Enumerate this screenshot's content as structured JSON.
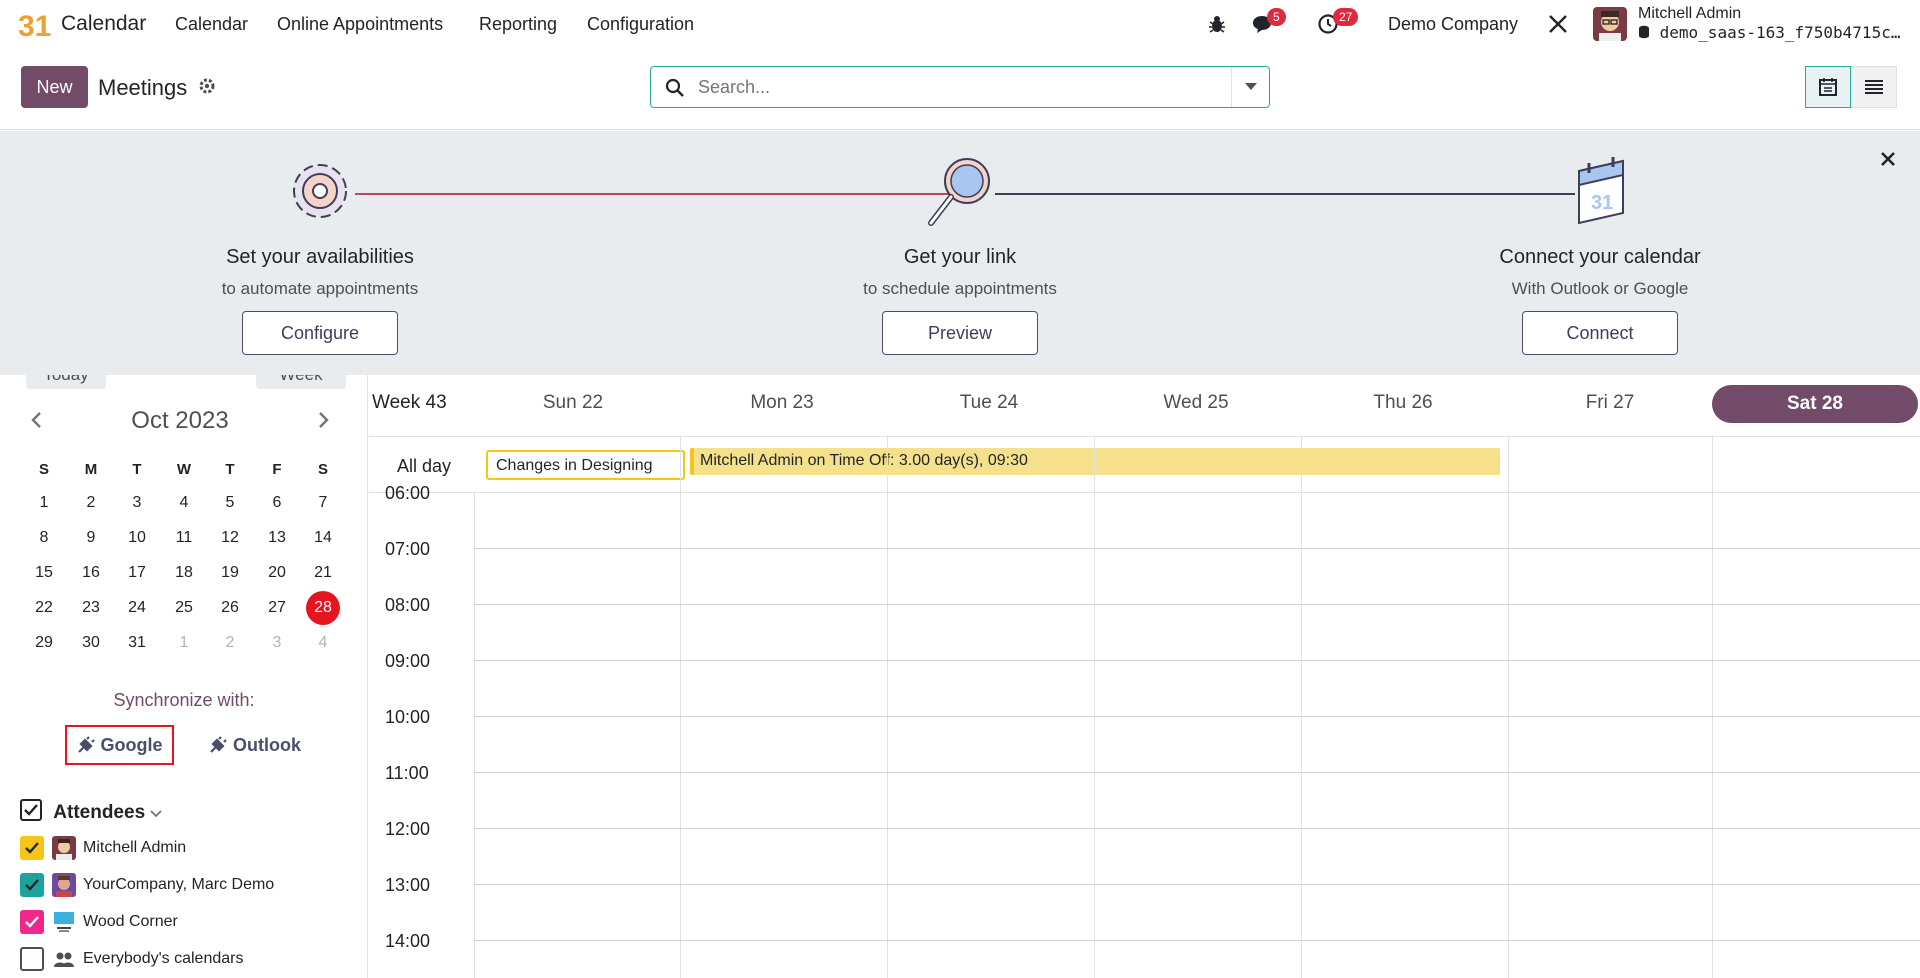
{
  "navbar": {
    "app_name": "Calendar",
    "logo_text": "31",
    "menu": [
      "Calendar",
      "Online Appointments",
      "Reporting",
      "Configuration"
    ],
    "messages_count": "5",
    "activities_count": "27",
    "company": "Demo Company",
    "user_name": "Mitchell Admin",
    "db_name": "demo_saas-163_f750b4715c…"
  },
  "control": {
    "new_label": "New",
    "breadcrumb": "Meetings",
    "search_placeholder": "Search..."
  },
  "banner": {
    "steps": [
      {
        "title": "Set your availabilities",
        "subtitle": "to automate appointments",
        "button": "Configure"
      },
      {
        "title": "Get your link",
        "subtitle": "to schedule appointments",
        "button": "Preview"
      },
      {
        "title": "Connect your calendar",
        "subtitle": "With Outlook or Google",
        "button": "Connect"
      }
    ]
  },
  "sidebar": {
    "today_label": "Today",
    "scale_label": "Week",
    "month_title": "Oct 2023",
    "dow": [
      "S",
      "M",
      "T",
      "W",
      "T",
      "F",
      "S"
    ],
    "weeks": [
      [
        "1",
        "2",
        "3",
        "4",
        "5",
        "6",
        "7"
      ],
      [
        "8",
        "9",
        "10",
        "11",
        "12",
        "13",
        "14"
      ],
      [
        "15",
        "16",
        "17",
        "18",
        "19",
        "20",
        "21"
      ],
      [
        "22",
        "23",
        "24",
        "25",
        "26",
        "27",
        "28"
      ],
      [
        "29",
        "30",
        "31",
        "1",
        "2",
        "3",
        "4"
      ]
    ],
    "today_day": "28",
    "sync_label": "Synchronize with:",
    "google_label": "Google",
    "outlook_label": "Outlook",
    "attendees_label": "Attendees",
    "attendees": [
      {
        "name": "Mitchell Admin",
        "color": "#f5c518",
        "checked": true
      },
      {
        "name": "YourCompany, Marc Demo",
        "color": "#1ba39c",
        "checked": true
      },
      {
        "name": "Wood Corner",
        "color": "#f0288c",
        "checked": true
      },
      {
        "name": "Everybody's calendars",
        "color": "#ffffff",
        "checked": false
      }
    ]
  },
  "calendar": {
    "week_label": "Week 43",
    "days": [
      "Sun 22",
      "Mon 23",
      "Tue 24",
      "Wed 25",
      "Thu 26",
      "Fri 27",
      "Sat 28"
    ],
    "active_day": "Sat 28",
    "allday_label": "All day",
    "events": [
      {
        "title": "Changes in Designing"
      },
      {
        "title": "Mitchell Admin on Time Off: 3.00 day(s), 09:30"
      }
    ],
    "hours": [
      "06:00",
      "07:00",
      "08:00",
      "09:00",
      "10:00",
      "11:00",
      "12:00",
      "13:00",
      "14:00"
    ]
  },
  "colors": {
    "brand": "#714b67",
    "accent": "#25a8a0",
    "today": "#e6141f",
    "event_yellow": "#f5e18c"
  }
}
